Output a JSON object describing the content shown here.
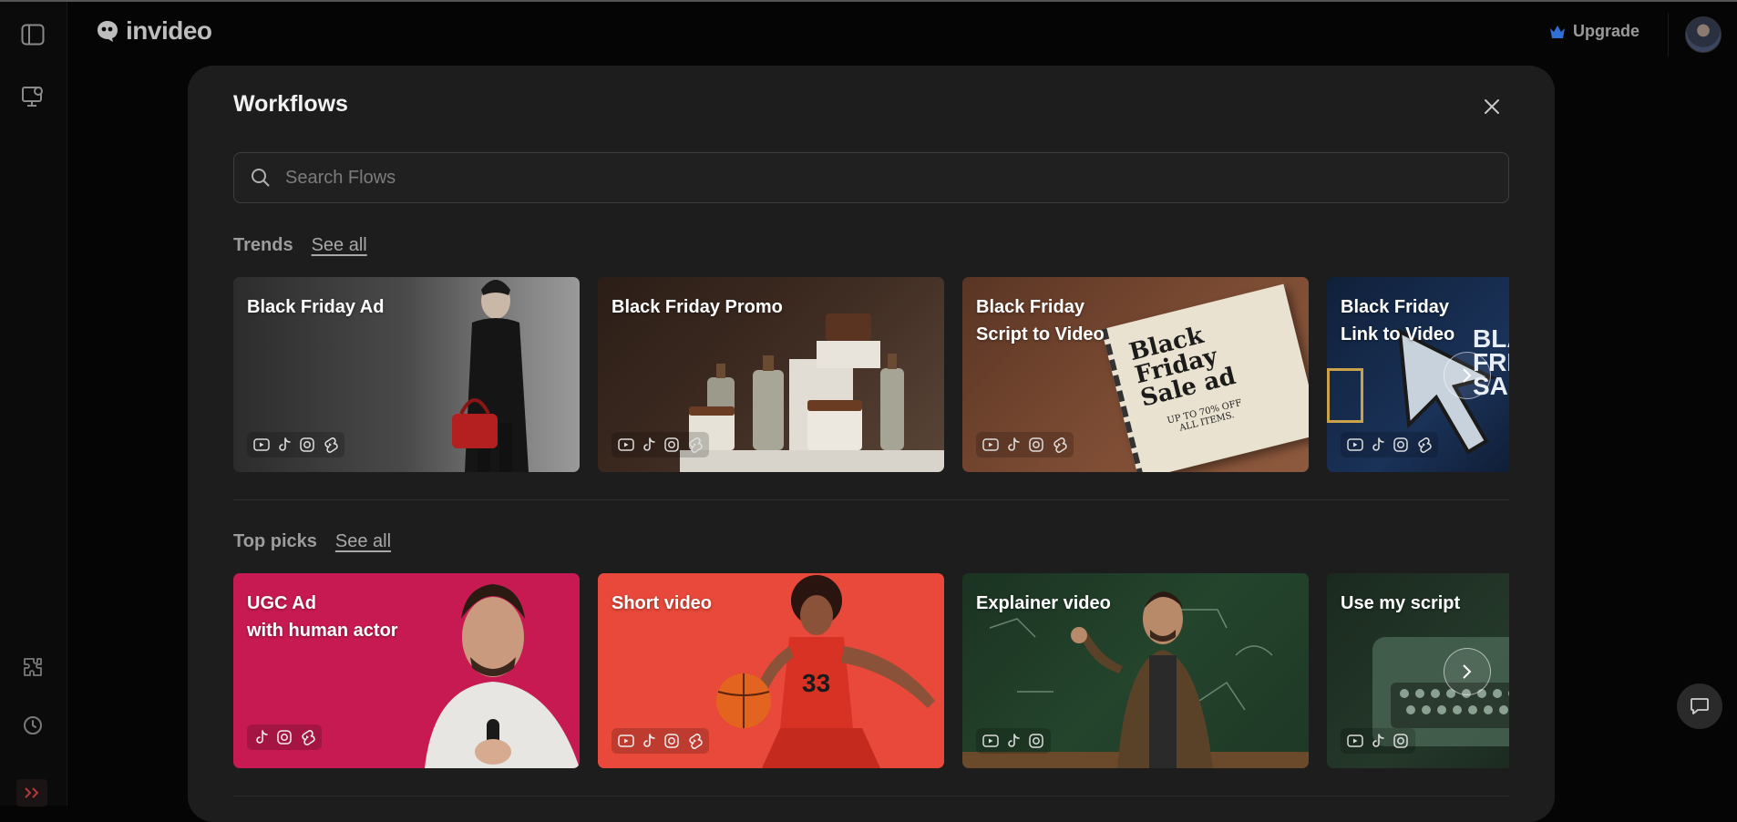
{
  "app": {
    "logo_text": "invideo",
    "upgrade_label": "Upgrade"
  },
  "modal": {
    "title": "Workflows"
  },
  "search": {
    "placeholder": "Search Flows",
    "value": ""
  },
  "sections": {
    "trends": {
      "title": "Trends",
      "see_all": "See all",
      "cards": [
        {
          "title": "Black Friday Ad",
          "platforms": [
            "youtube-icon",
            "tiktok-icon",
            "instagram-icon",
            "shorts-icon"
          ]
        },
        {
          "title": "Black Friday Promo",
          "platforms": [
            "youtube-icon",
            "tiktok-icon",
            "instagram-icon",
            "shorts-icon"
          ]
        },
        {
          "title": "Black Friday\nScript to Video",
          "platforms": [
            "youtube-icon",
            "tiktok-icon",
            "instagram-icon",
            "shorts-icon"
          ],
          "image_text": {
            "line1": "Black",
            "line2": "Friday",
            "line3": "Sale ad",
            "line4": "UP TO 70% OFF",
            "line5": "ALL ITEMS."
          }
        },
        {
          "title": "Black Friday\nLink to Video",
          "platforms": [
            "youtube-icon",
            "tiktok-icon",
            "instagram-icon",
            "shorts-icon"
          ],
          "image_text": {
            "line1": "BLA",
            "line2": "FRI",
            "line3": "SA"
          }
        }
      ]
    },
    "top_picks": {
      "title": "Top picks",
      "see_all": "See all",
      "cards": [
        {
          "title": "UGC Ad\nwith human actor",
          "platforms": [
            "tiktok-icon",
            "instagram-icon",
            "shorts-icon"
          ]
        },
        {
          "title": "Short video",
          "platforms": [
            "youtube-icon",
            "tiktok-icon",
            "instagram-icon",
            "shorts-icon"
          ],
          "image_text": {
            "jersey": "33"
          }
        },
        {
          "title": "Explainer video",
          "platforms": [
            "youtube-icon",
            "tiktok-icon",
            "instagram-icon"
          ]
        },
        {
          "title": "Use my script",
          "platforms": [
            "youtube-icon",
            "tiktok-icon",
            "instagram-icon"
          ]
        }
      ]
    }
  },
  "colors": {
    "background": "#050505",
    "modal": "#1d1d1d",
    "ugc_card": "#c81a52",
    "short_video_card": "#e8493a",
    "explainer_card": "#24442c",
    "script_card": "#1f3024",
    "upgrade_icon": "#2f6fd6"
  }
}
